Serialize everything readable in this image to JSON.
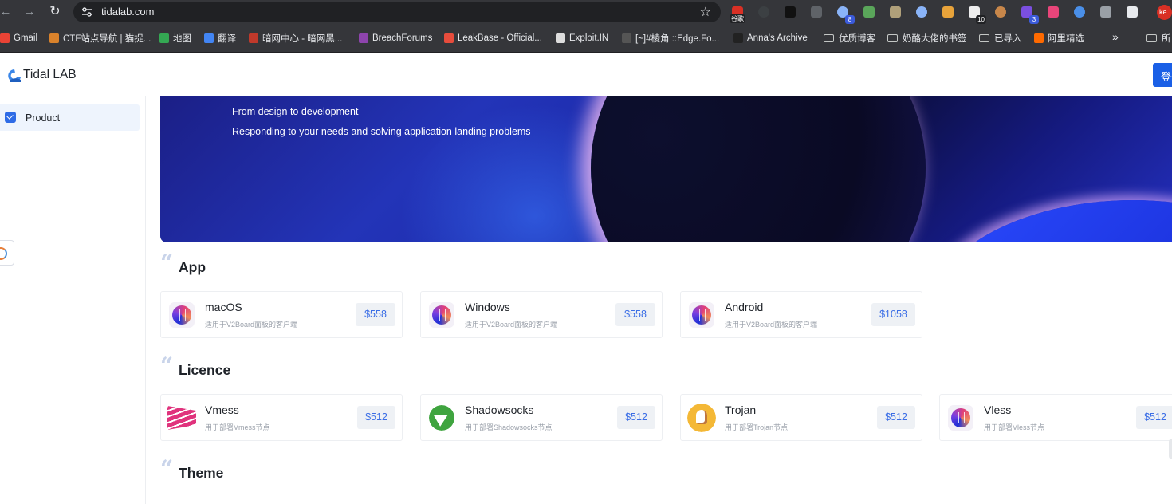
{
  "browser": {
    "url": "tidalab.com",
    "extensions": [
      {
        "name": "guge-extension-icon",
        "color": "#d93025",
        "badge": "谷歌"
      },
      {
        "name": "x-extension-icon",
        "color": "#3c4043",
        "badge": ""
      },
      {
        "name": "dark-extension-icon",
        "color": "#111111",
        "badge": ""
      },
      {
        "name": "hat-extension-icon",
        "color": "#5f6368",
        "badge": ""
      },
      {
        "name": "grid-extension-icon",
        "color": "#8ab4f8",
        "badge": "8"
      },
      {
        "name": "puzzle-green-extension-icon",
        "color": "#5aa65a",
        "badge": ""
      },
      {
        "name": "ring-extension-icon",
        "color": "#b0a07a",
        "badge": ""
      },
      {
        "name": "circle-blue-extension-icon",
        "color": "#8ab4f8",
        "badge": ""
      },
      {
        "name": "chrome-extension-icon",
        "color": "#e8a33a",
        "badge": ""
      },
      {
        "name": "calendar-extension-icon",
        "color": "#eeeeee",
        "badge": "10"
      },
      {
        "name": "cookie-extension-icon",
        "color": "#c8874a",
        "badge": ""
      },
      {
        "name": "purple-extension-icon",
        "color": "#7b4fe0",
        "badge": "3"
      },
      {
        "name": "translate-extension-icon",
        "color": "#e8457a",
        "badge": ""
      },
      {
        "name": "doc-extension-icon",
        "color": "#4a8fe8",
        "badge": ""
      },
      {
        "name": "gear-extension-icon",
        "color": "#9aa0a6",
        "badge": ""
      },
      {
        "name": "puzzle-extension-icon",
        "color": "#e8eaed",
        "badge": ""
      }
    ],
    "profile_initials": "ke",
    "bookmarks": [
      {
        "label": "Gmail",
        "kind": "fav",
        "color": "#ea4335"
      },
      {
        "label": "CTF站点导航 | 猫捉...",
        "kind": "fav",
        "color": "#d9822b"
      },
      {
        "label": "地图",
        "kind": "fav",
        "color": "#34a853"
      },
      {
        "label": "翻译",
        "kind": "fav",
        "color": "#4285f4"
      },
      {
        "label": "暗网中心 - 暗网黑...",
        "kind": "fav",
        "color": "#c0392b"
      },
      {
        "label": "BreachForums",
        "kind": "fav",
        "color": "#8e44ad"
      },
      {
        "label": "LeakBase - Official...",
        "kind": "fav",
        "color": "#e74c3c"
      },
      {
        "label": "Exploit.IN",
        "kind": "fav",
        "color": "#dddddd"
      },
      {
        "label": "[~]#棱角 ::Edge.Fo...",
        "kind": "fav",
        "color": "#555555"
      },
      {
        "label": "Anna's Archive",
        "kind": "fav",
        "color": "#222222"
      },
      {
        "label": "优质博客",
        "kind": "folder",
        "color": ""
      },
      {
        "label": "奶酪大佬的书签",
        "kind": "folder",
        "color": ""
      },
      {
        "label": "已导入",
        "kind": "folder",
        "color": ""
      },
      {
        "label": "阿里精选",
        "kind": "fav",
        "color": "#ff6a00"
      },
      {
        "label": "所",
        "kind": "folder",
        "color": ""
      }
    ],
    "more_glyph": "»"
  },
  "header": {
    "brand": "Tidal LAB",
    "login_label": "登录"
  },
  "sidebar": {
    "items": [
      {
        "label": "Product"
      }
    ]
  },
  "banner": {
    "line1": "From design to development",
    "line2": "Responding to your needs and solving application landing problems"
  },
  "sections": {
    "app": {
      "title": "App",
      "cards": [
        {
          "name": "macOS",
          "desc": "适用于V2Board面板的客户端",
          "price": "$558"
        },
        {
          "name": "Windows",
          "desc": "适用于V2Board面板的客户端",
          "price": "$558"
        },
        {
          "name": "Android",
          "desc": "适用于V2Board面板的客户端",
          "price": "$1058"
        }
      ]
    },
    "licence": {
      "title": "Licence",
      "cards": [
        {
          "name": "Vmess",
          "desc": "用于部署Vmess节点",
          "price": "$512"
        },
        {
          "name": "Shadowsocks",
          "desc": "用于部署Shadowsocks节点",
          "price": "$512"
        },
        {
          "name": "Trojan",
          "desc": "用于部署Trojan节点",
          "price": "$512"
        },
        {
          "name": "Vless",
          "desc": "用于部署Vless节点",
          "price": "$512"
        }
      ]
    },
    "theme": {
      "title": "Theme"
    }
  }
}
